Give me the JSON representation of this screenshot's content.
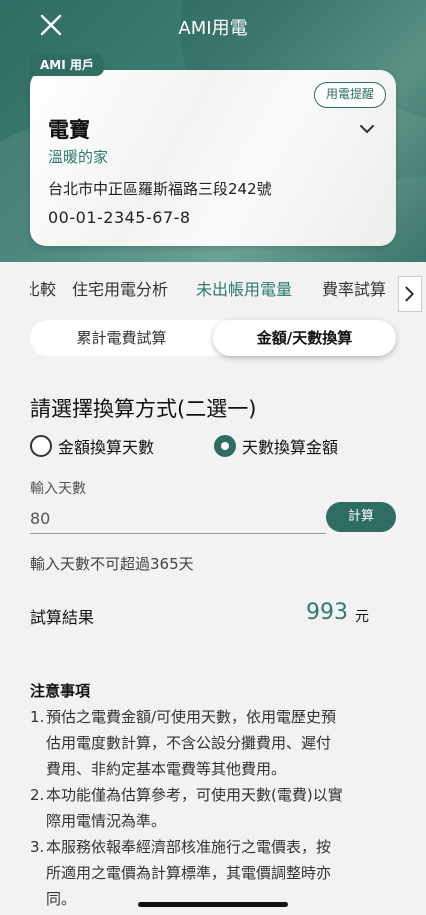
{
  "header": {
    "title": "AMI用電",
    "close_icon": "close-icon"
  },
  "account_card": {
    "badge": "AMI 用戶",
    "alert_button": "用電提醒",
    "name": "電寶",
    "nickname": "溫暖的家",
    "address": "台北市中正區羅斯福路三段242號",
    "account_number": "00-01-2345-67-8",
    "expand_icon": "chevron-down-icon"
  },
  "tabs": {
    "items": [
      {
        "label": "比較"
      },
      {
        "label": "住宅用電分析"
      },
      {
        "label": "未出帳用電量"
      },
      {
        "label": "費率試算"
      }
    ],
    "active_index": 2,
    "more_icon": "chevron-right-icon"
  },
  "segment": {
    "options": [
      "累計電費試算",
      "金額/天數換算"
    ],
    "selected": "金額/天數換算"
  },
  "method": {
    "title": "請選擇換算方式(二選一)",
    "options": [
      "金額換算天數",
      "天數換算金額"
    ],
    "selected": "天數換算金額"
  },
  "input": {
    "label": "輸入天數",
    "value": "80",
    "button": "計算",
    "hint": "輸入天數不可超過365天"
  },
  "result": {
    "label": "試算結果",
    "value": "993",
    "unit": "元"
  },
  "notes": {
    "title": "注意事項",
    "items": [
      {
        "num": "1.",
        "lines": [
          "預估之電費金額/可使用天數，依用電歷史預",
          "估用電度數計算，不含公設分攤費用、遲付",
          "費用、非約定基本電費等其他費用。"
        ]
      },
      {
        "num": "2.",
        "lines": [
          "本功能僅為估算參考，可使用天數(電費)以實",
          "際用電情況為準。"
        ]
      },
      {
        "num": "3.",
        "lines": [
          "本服務依報奉經濟部核准施行之電價表，按",
          "所適用之電價為計算標準，其電價調整時亦",
          "同。"
        ]
      }
    ]
  },
  "colors": {
    "brand": "#2f6c63",
    "accent_text": "#2f7a6e"
  }
}
